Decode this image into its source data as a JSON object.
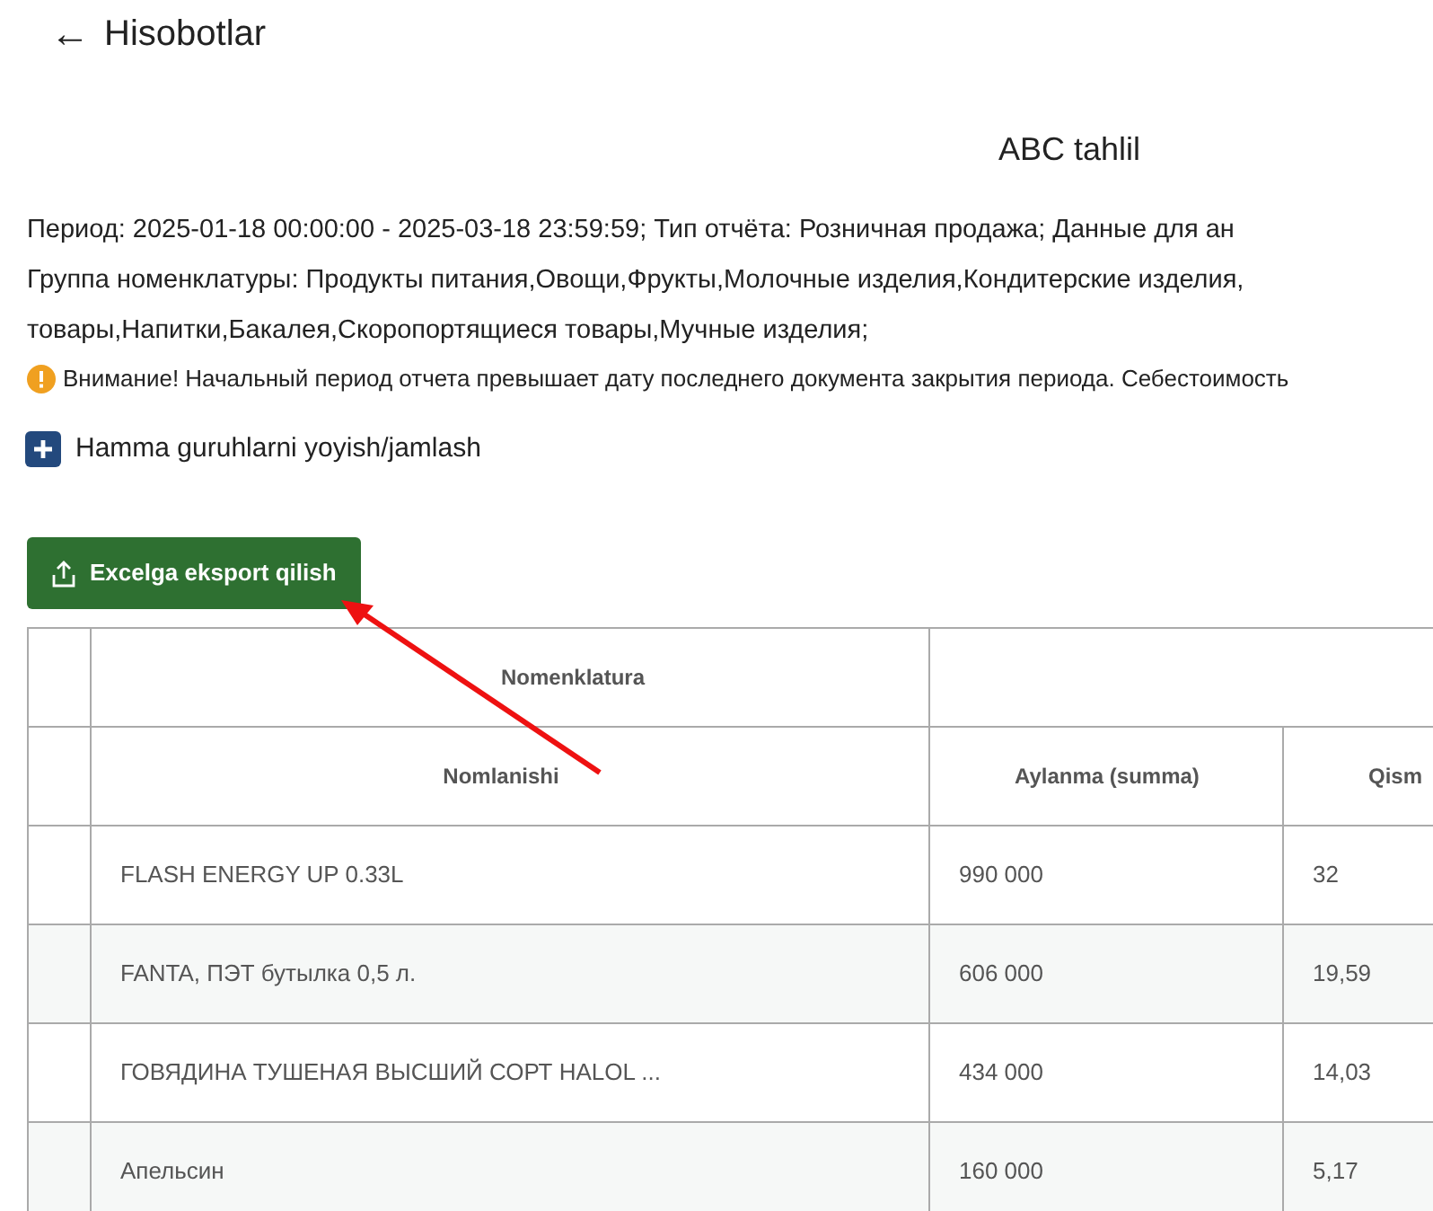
{
  "header": {
    "back_icon": "←",
    "title": "Hisobotlar"
  },
  "report": {
    "title": "ABC tahlil",
    "params_lines": [
      "Период: 2025-01-18 00:00:00 - 2025-03-18 23:59:59; Тип отчёта: Розничная продажа; Данные для ан",
      "Группа номенклатуры: Продукты питания,Овощи,Фрукты,Молочные изделия,Кондитерские изделия,",
      "товары,Напитки,Бакалея,Скоропортящиеся товары,Мучные изделия;"
    ],
    "warning": "Внимание! Начальный период отчета превышает дату последнего документа закрытия периода. Себестоимость"
  },
  "toggle_groups": {
    "label": "Hamma guruhlarni yoyish/jamlash"
  },
  "export_button": {
    "label": "Excelga eksport qilish"
  },
  "table": {
    "group_header": "Nomenklatura",
    "columns": [
      "Nomlanishi",
      "Aylanma (summa)",
      "Qism"
    ],
    "rows": [
      [
        "FLASH ENERGY UP 0.33L",
        "990 000",
        "32"
      ],
      [
        "FANTA, ПЭТ бутылка 0,5 л.",
        "606 000",
        "19,59"
      ],
      [
        "ГОВЯДИНА ТУШЕНАЯ ВЫСШИЙ СОРТ HALOL ...",
        "434 000",
        "14,03"
      ],
      [
        "Апельсин",
        "160 000",
        "5,17"
      ]
    ]
  }
}
